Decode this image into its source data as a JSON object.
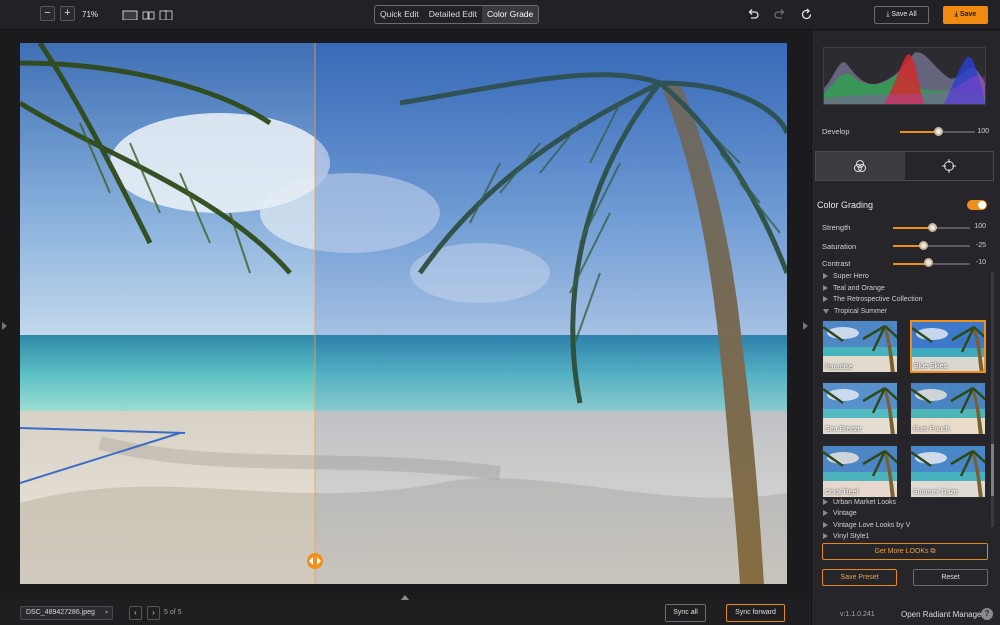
{
  "toolbar": {
    "zoom_out": "−",
    "zoom_in": "+",
    "zoom_value": "71%",
    "modes": [
      "Quick Edit",
      "Detailed Edit",
      "Color Grade"
    ],
    "active_mode": "Color Grade",
    "save_all": "Save All",
    "save": "Save"
  },
  "bottom": {
    "file_name": "DSC_489427286.jpeg",
    "prev": "‹",
    "next": "›",
    "page_count": "5 of 5",
    "sync_all": "Sync all",
    "sync_forward": "Sync forward"
  },
  "panel": {
    "develop": {
      "label": "Develop",
      "value": "100",
      "level": 0.55
    },
    "section_title": "Color Grading",
    "grading_enabled": true,
    "sliders": [
      {
        "label": "Strength",
        "value": "100",
        "level": 0.5
      },
      {
        "label": "Saturation",
        "value": "-25",
        "level": 0.38
      },
      {
        "label": "Contrast",
        "value": "-10",
        "level": 0.45
      }
    ],
    "categories_top": [
      "Super Hero",
      "Teal and Orange",
      "The Retrospective Collection"
    ],
    "open_category": "Tropical Summer",
    "looks": [
      {
        "name": "Paradise",
        "selected": false
      },
      {
        "name": "Blue Skies",
        "selected": true
      },
      {
        "name": "Sea Breeze",
        "selected": false
      },
      {
        "name": "Rum Punch",
        "selected": false
      },
      {
        "name": "Coral Reef",
        "selected": false
      },
      {
        "name": "Summer Daze",
        "selected": false
      }
    ],
    "categories_bottom": [
      "Urban Market Looks",
      "Vintage",
      "Vintage Love  Looks by V",
      "Vinyl Style1"
    ],
    "get_more": "Get More LOOKs",
    "save_preset": "Save Preset",
    "reset": "Reset",
    "version": "v:1.1.0.241",
    "manager": "Open Radiant Manager",
    "help": "?"
  },
  "colors": {
    "accent": "#f0901a",
    "panel_bg": "#25252a",
    "app_bg": "#1f1f22"
  }
}
